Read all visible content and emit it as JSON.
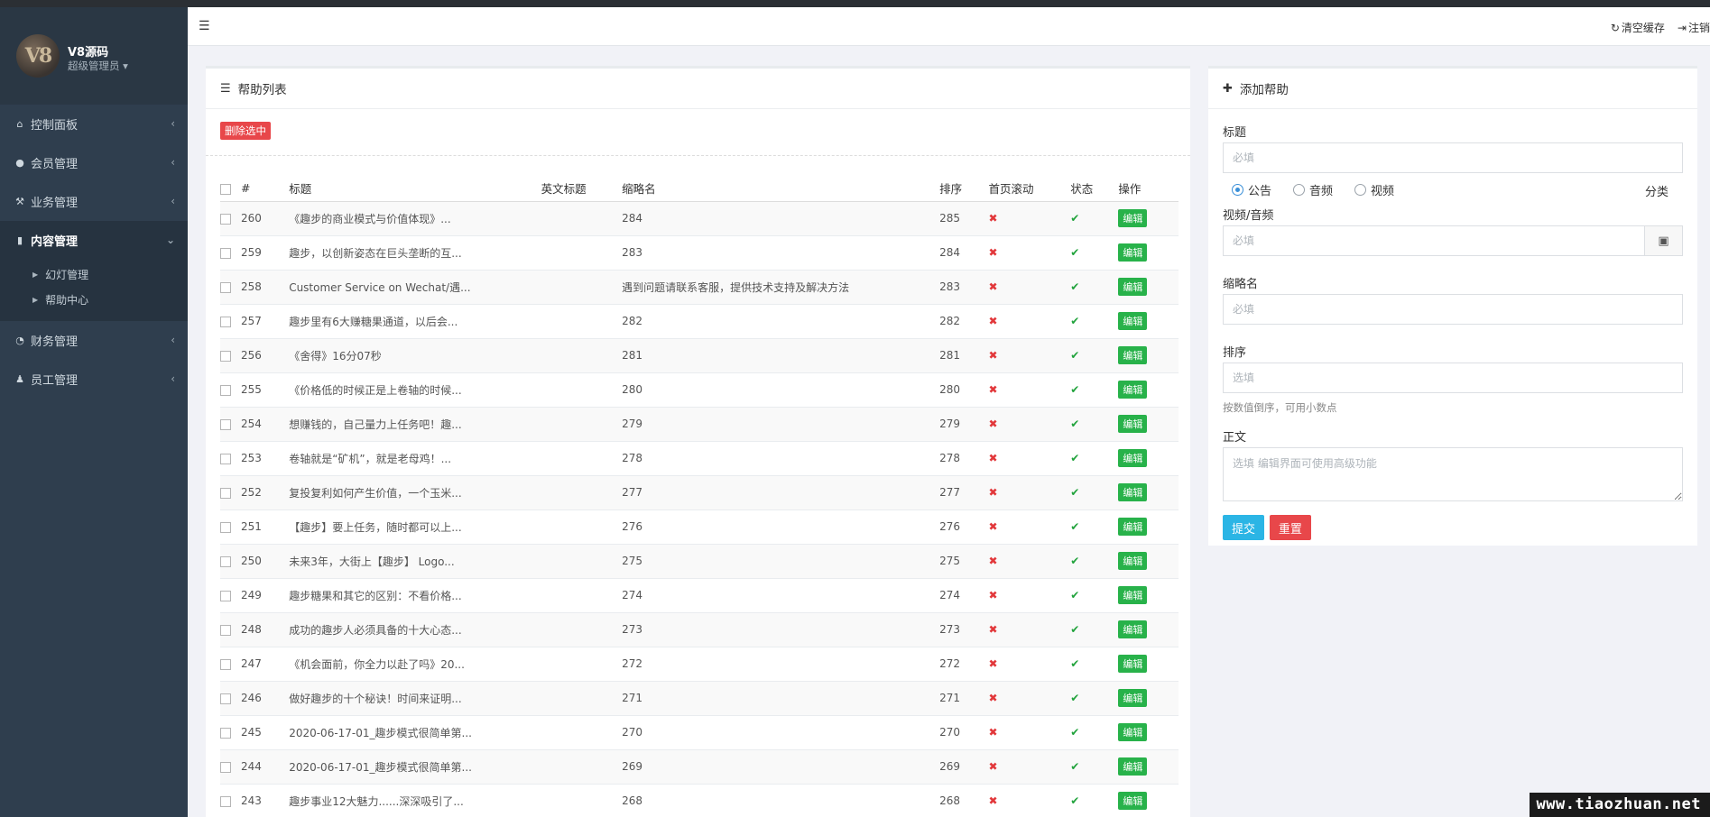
{
  "profile": {
    "name": "V8源码",
    "role": "超级管理员 ▾",
    "avatar_text": "V8"
  },
  "sidebar": {
    "items": [
      {
        "label": "控制面板",
        "icon": "home-icon",
        "glyph": "⌂"
      },
      {
        "label": "会员管理",
        "icon": "user-icon",
        "glyph": "●"
      },
      {
        "label": "业务管理",
        "icon": "gavel-icon",
        "glyph": "⚒"
      },
      {
        "label": "内容管理",
        "icon": "book-icon",
        "glyph": "▮",
        "active": true
      },
      {
        "label": "财务管理",
        "icon": "pie-chart-icon",
        "glyph": "◔"
      },
      {
        "label": "员工管理",
        "icon": "staff-icon",
        "glyph": "♟"
      }
    ],
    "submenu": [
      "幻灯管理",
      "帮助中心"
    ]
  },
  "header": {
    "clear_cache": "清空缓存",
    "logout": "注销"
  },
  "list_panel": {
    "title": "帮助列表",
    "delete_selected": "删除选中",
    "columns": [
      "#",
      "标题",
      "英文标题",
      "缩略名",
      "排序",
      "首页滚动",
      "状态",
      "操作"
    ],
    "edit_label": "编辑",
    "rows": [
      {
        "id": "260",
        "title": "《趣步的商业模式与价值体现》...",
        "en": "",
        "slug": "284",
        "sort": "285",
        "scroll": false,
        "status": true
      },
      {
        "id": "259",
        "title": "趣步，以创新姿态在巨头垄断的互...",
        "en": "",
        "slug": "283",
        "sort": "284",
        "scroll": false,
        "status": true
      },
      {
        "id": "258",
        "title": "Customer Service on Wechat/遇...",
        "en": "",
        "slug": "遇到问题请联系客服，提供技术支持及解决方法",
        "sort": "283",
        "scroll": false,
        "status": true
      },
      {
        "id": "257",
        "title": "趣步里有6大赚糖果通道，以后会...",
        "en": "",
        "slug": "282",
        "sort": "282",
        "scroll": false,
        "status": true
      },
      {
        "id": "256",
        "title": "《舍得》16分07秒",
        "en": "",
        "slug": "281",
        "sort": "281",
        "scroll": false,
        "status": true
      },
      {
        "id": "255",
        "title": "《价格低的时候正是上卷轴的时候...",
        "en": "",
        "slug": "280",
        "sort": "280",
        "scroll": false,
        "status": true
      },
      {
        "id": "254",
        "title": "想赚钱的，自己量力上任务吧！趣...",
        "en": "",
        "slug": "279",
        "sort": "279",
        "scroll": false,
        "status": true
      },
      {
        "id": "253",
        "title": "卷轴就是“矿机”，就是老母鸡！...",
        "en": "",
        "slug": "278",
        "sort": "278",
        "scroll": false,
        "status": true
      },
      {
        "id": "252",
        "title": "复投复利如何产生价值，一个玉米...",
        "en": "",
        "slug": "277",
        "sort": "277",
        "scroll": false,
        "status": true
      },
      {
        "id": "251",
        "title": "【趣步】要上任务，随时都可以上...",
        "en": "",
        "slug": "276",
        "sort": "276",
        "scroll": false,
        "status": true
      },
      {
        "id": "250",
        "title": "未来3年，大街上【趣步】 Logo...",
        "en": "",
        "slug": "275",
        "sort": "275",
        "scroll": false,
        "status": true
      },
      {
        "id": "249",
        "title": "趣步糖果和其它的区别：不看价格...",
        "en": "",
        "slug": "274",
        "sort": "274",
        "scroll": false,
        "status": true
      },
      {
        "id": "248",
        "title": "成功的趣步人必须具备的十大心态...",
        "en": "",
        "slug": "273",
        "sort": "273",
        "scroll": false,
        "status": true
      },
      {
        "id": "247",
        "title": "《机会面前，你全力以赴了吗》20...",
        "en": "",
        "slug": "272",
        "sort": "272",
        "scroll": false,
        "status": true
      },
      {
        "id": "246",
        "title": "做好趣步的十个秘诀！时间来证明...",
        "en": "",
        "slug": "271",
        "sort": "271",
        "scroll": false,
        "status": true
      },
      {
        "id": "245",
        "title": "2020-06-17-01_趣步模式很简单第...",
        "en": "",
        "slug": "270",
        "sort": "270",
        "scroll": false,
        "status": true
      },
      {
        "id": "244",
        "title": "2020-06-17-01_趣步模式很简单第...",
        "en": "",
        "slug": "269",
        "sort": "269",
        "scroll": false,
        "status": true
      },
      {
        "id": "243",
        "title": "趣步事业12大魅力......深深吸引了...",
        "en": "",
        "slug": "268",
        "sort": "268",
        "scroll": false,
        "status": true
      }
    ]
  },
  "form_panel": {
    "title": "添加帮助",
    "title_label": "标题",
    "title_placeholder": "必填",
    "radio_options": [
      "公告",
      "音频",
      "视频"
    ],
    "selected_radio": 0,
    "category_label": "分类",
    "media_label": "视频/音频",
    "media_placeholder": "必填",
    "slug_label": "缩略名",
    "slug_placeholder": "必填",
    "sort_label": "排序",
    "sort_placeholder": "选填",
    "sort_help": "按数值倒序，可用小数点",
    "body_label": "正文",
    "body_placeholder": "选填 编辑界面可使用高级功能",
    "submit": "提交",
    "reset": "重置"
  },
  "watermark": "www.tiaozhuan.net",
  "colors": {
    "danger": "#e8474a",
    "success": "#28b24a",
    "info": "#2bb5e5",
    "sidebar": "#2f3e4e"
  }
}
